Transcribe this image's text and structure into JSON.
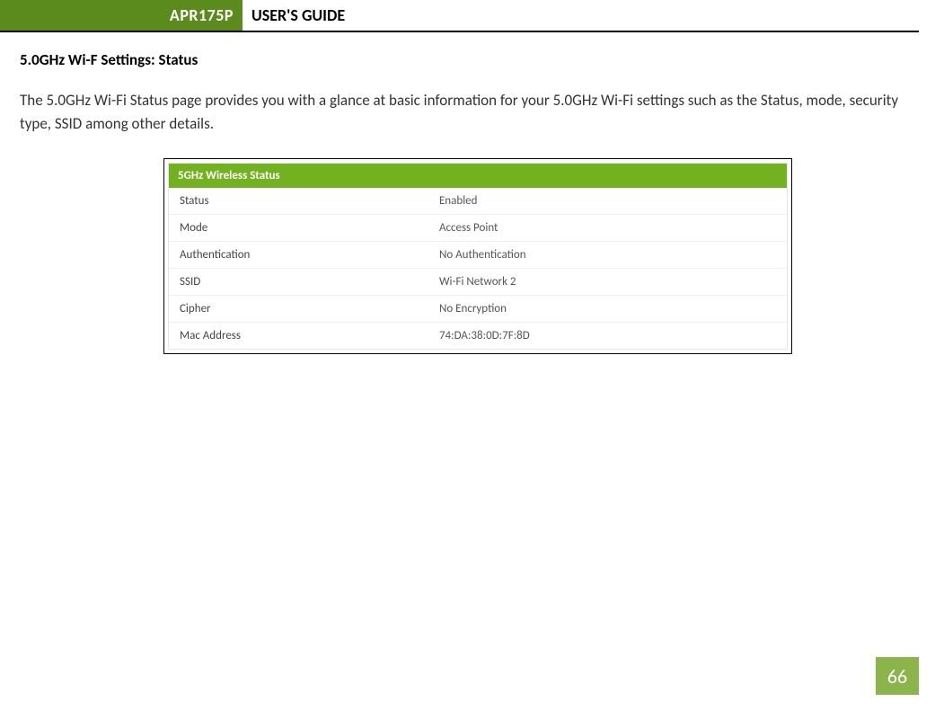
{
  "header": {
    "product": "APR175P",
    "doc_title": "USER'S GUIDE"
  },
  "section": {
    "heading": "5.0GHz Wi-F Settings: Status",
    "paragraph": "The 5.0GHz Wi-Fi Status page provides you with a glance at basic information for your 5.0GHz Wi-Fi settings such as the Status, mode, security type, SSID among other details."
  },
  "panel": {
    "title": "5GHz Wireless Status",
    "rows": [
      {
        "label": "Status",
        "value": "Enabled"
      },
      {
        "label": "Mode",
        "value": "Access Point"
      },
      {
        "label": "Authentication",
        "value": "No Authentication"
      },
      {
        "label": "SSID",
        "value": "Wi-Fi Network 2"
      },
      {
        "label": "Cipher",
        "value": "No Encryption"
      },
      {
        "label": "Mac Address",
        "value": "74:DA:38:0D:7F:8D"
      }
    ]
  },
  "page_number": "66"
}
